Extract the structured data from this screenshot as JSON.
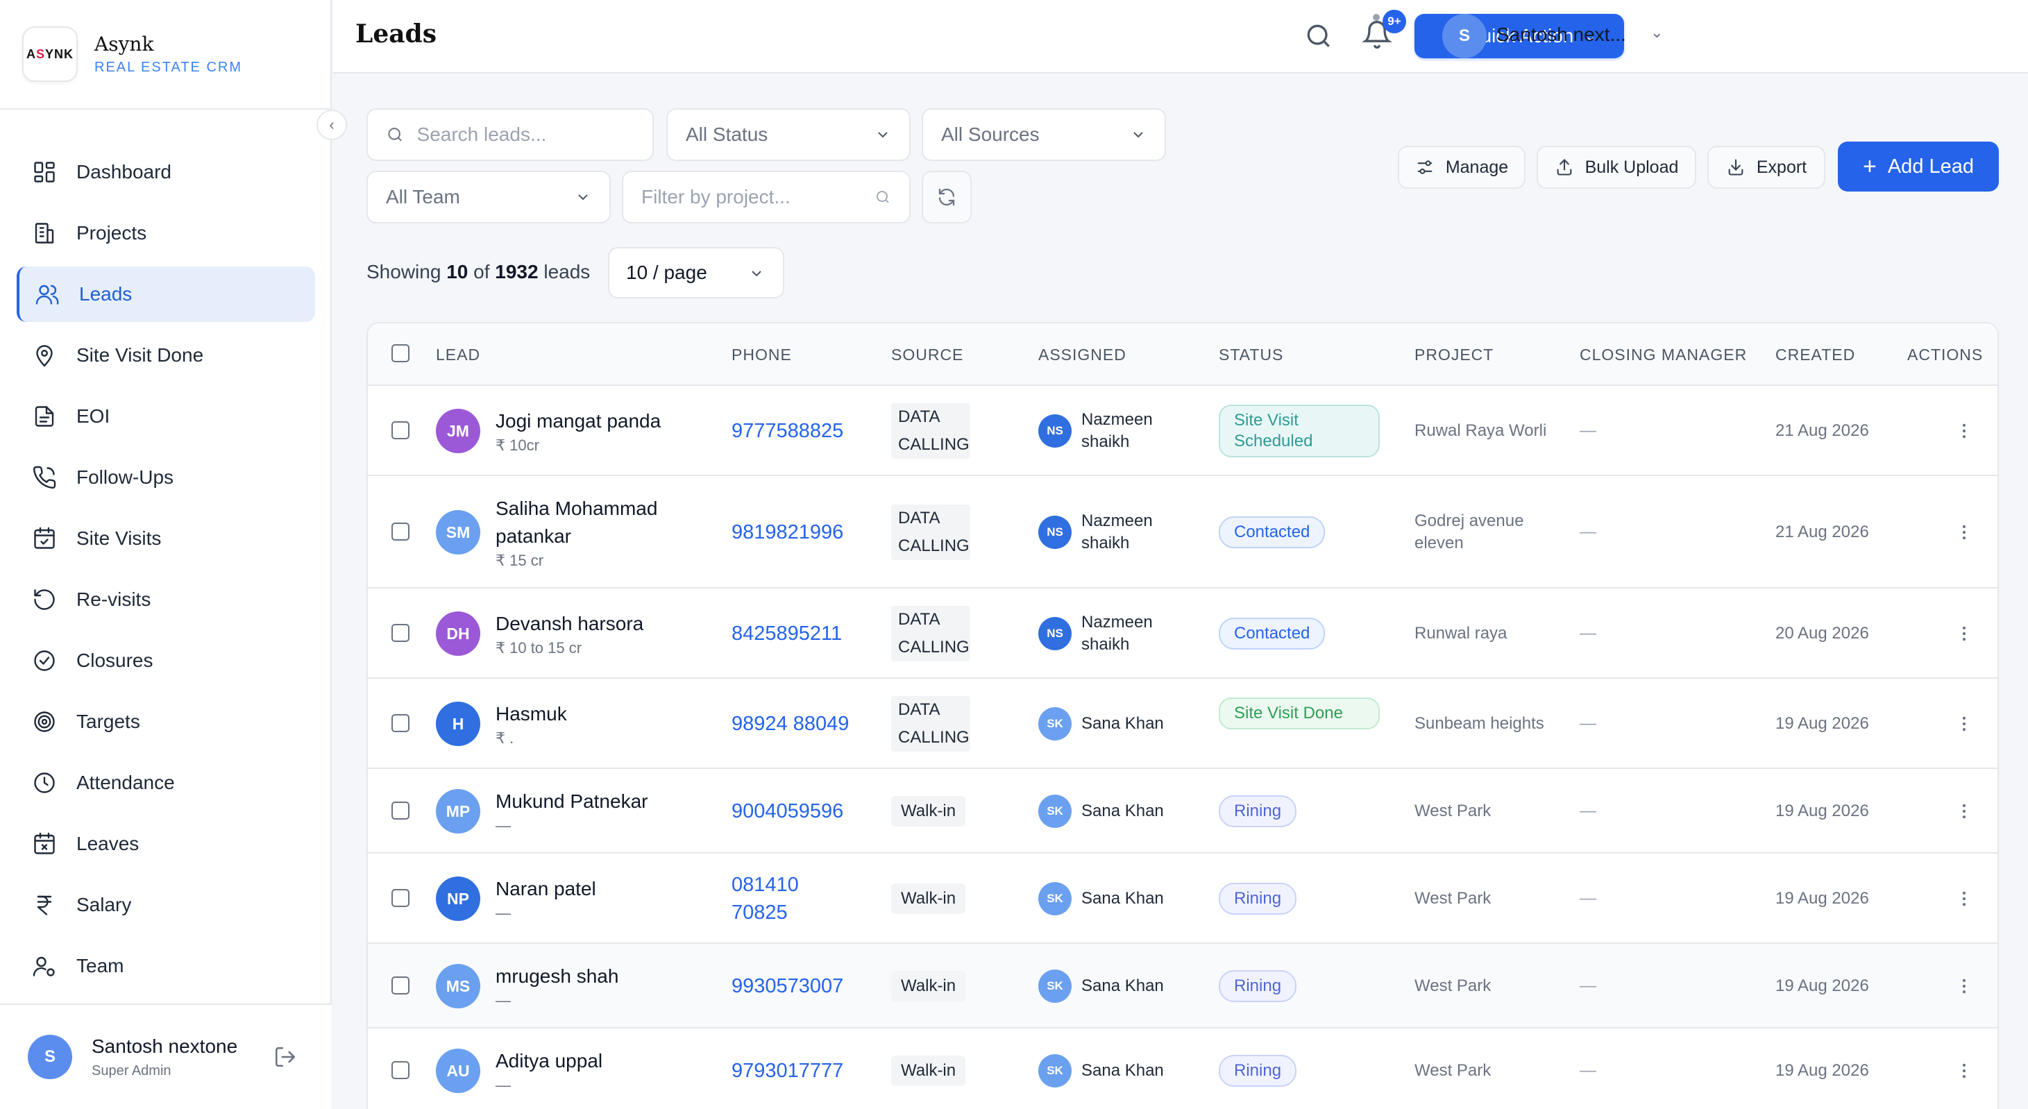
{
  "brand": {
    "logo_left": "A",
    "logo_mid": "S",
    "logo_right": "YNK",
    "name": "Asynk",
    "subtitle": "REAL ESTATE CRM"
  },
  "sidebar": {
    "items": [
      {
        "label": "Dashboard",
        "icon": "dashboard-icon"
      },
      {
        "label": "Projects",
        "icon": "building-icon"
      },
      {
        "label": "Leads",
        "icon": "users-icon",
        "active": true
      },
      {
        "label": "Site Visit Done",
        "icon": "map-pin-icon"
      },
      {
        "label": "EOI",
        "icon": "document-icon"
      },
      {
        "label": "Follow-Ups",
        "icon": "phone-icon"
      },
      {
        "label": "Site Visits",
        "icon": "calendar-check-icon"
      },
      {
        "label": "Re-visits",
        "icon": "rotate-icon"
      },
      {
        "label": "Closures",
        "icon": "check-circle-icon"
      },
      {
        "label": "Targets",
        "icon": "target-icon"
      },
      {
        "label": "Attendance",
        "icon": "clock-icon"
      },
      {
        "label": "Leaves",
        "icon": "calendar-x-icon"
      },
      {
        "label": "Salary",
        "icon": "rupee-icon"
      },
      {
        "label": "Team",
        "icon": "user-cog-icon"
      }
    ],
    "footer": {
      "initial": "S",
      "name": "Santosh nextone",
      "role": "Super Admin"
    }
  },
  "header": {
    "title": "Leads",
    "quick_action": "Quick Action",
    "notification_badge": "9+",
    "user_initial": "S",
    "user_name": "Santosh next..."
  },
  "filters": {
    "search_placeholder": "Search leads...",
    "status": "All Status",
    "sources": "All Sources",
    "team": "All Team",
    "project_placeholder": "Filter by project..."
  },
  "toolbar": {
    "manage": "Manage",
    "bulk_upload": "Bulk Upload",
    "export": "Export",
    "add_lead": "Add Lead"
  },
  "summary": {
    "prefix": "Showing",
    "shown": "10",
    "of": "of",
    "total": "1932",
    "suffix": "leads",
    "per_page": "10 / page"
  },
  "table": {
    "headers": [
      "LEAD",
      "PHONE",
      "SOURCE",
      "ASSIGNED",
      "STATUS",
      "PROJECT",
      "CLOSING MANAGER",
      "CREATED",
      "ACTIONS"
    ],
    "rows": [
      {
        "initials": "JM",
        "avatar_color": "#9b59d8",
        "name": "Jogi mangat panda",
        "budget": "₹ 10cr",
        "phone": "9777588825",
        "source": "DATA CALLING",
        "assigned_initials": "NS",
        "assigned_color": "#2f6fe0",
        "assigned": "Nazmeen shaikh",
        "status": "Site Visit Scheduled",
        "status_tone": "teal",
        "project": "Ruwal Raya Worli",
        "closing_manager": "—",
        "created": "21 Aug 2026"
      },
      {
        "initials": "SM",
        "avatar_color": "#6aa0ef",
        "name": "Saliha Mohammad patankar",
        "budget": "₹ 15 cr",
        "phone": "9819821996",
        "source": "DATA CALLING",
        "assigned_initials": "NS",
        "assigned_color": "#2f6fe0",
        "assigned": "Nazmeen shaikh",
        "status": "Contacted",
        "status_tone": "blue",
        "project": "Godrej avenue eleven",
        "closing_manager": "—",
        "created": "21 Aug 2026"
      },
      {
        "initials": "DH",
        "avatar_color": "#9b59d8",
        "name": "Devansh harsora",
        "budget": "₹ 10 to 15 cr",
        "phone": "8425895211",
        "source": "DATA CALLING",
        "assigned_initials": "NS",
        "assigned_color": "#2f6fe0",
        "assigned": "Nazmeen shaikh",
        "status": "Contacted",
        "status_tone": "blue",
        "project": "Runwal raya",
        "closing_manager": "—",
        "created": "20 Aug 2026"
      },
      {
        "initials": "H",
        "avatar_color": "#2f6fe0",
        "name": "Hasmuk",
        "budget": "₹ .",
        "phone": "98924 88049",
        "source": "DATA CALLING",
        "assigned_initials": "SK",
        "assigned_color": "#6aa0ef",
        "assigned": "Sana Khan",
        "status": "Site Visit Done",
        "status_tone": "green",
        "project": "Sunbeam heights",
        "closing_manager": "—",
        "created": "19 Aug 2026"
      },
      {
        "initials": "MP",
        "avatar_color": "#6aa0ef",
        "name": "Mukund Patnekar",
        "budget": "—",
        "phone": "9004059596",
        "source": "Walk-in",
        "assigned_initials": "SK",
        "assigned_color": "#6aa0ef",
        "assigned": "Sana Khan",
        "status": "Rining",
        "status_tone": "purple",
        "project": "West Park",
        "closing_manager": "—",
        "created": "19 Aug 2026"
      },
      {
        "initials": "NP",
        "avatar_color": "#2f6fe0",
        "name": "Naran patel",
        "budget": "—",
        "phone": "081410 70825",
        "source": "Walk-in",
        "assigned_initials": "SK",
        "assigned_color": "#6aa0ef",
        "assigned": "Sana Khan",
        "status": "Rining",
        "status_tone": "purple",
        "project": "West Park",
        "closing_manager": "—",
        "created": "19 Aug 2026"
      },
      {
        "initials": "MS",
        "avatar_color": "#6aa0ef",
        "name": "mrugesh shah",
        "budget": "—",
        "phone": "9930573007",
        "source": "Walk-in",
        "assigned_initials": "SK",
        "assigned_color": "#6aa0ef",
        "assigned": "Sana Khan",
        "status": "Rining",
        "status_tone": "purple",
        "project": "West Park",
        "closing_manager": "—",
        "created": "19 Aug 2026"
      },
      {
        "initials": "AU",
        "avatar_color": "#6aa0ef",
        "name": "Aditya uppal",
        "budget": "—",
        "phone": "9793017777",
        "source": "Walk-in",
        "assigned_initials": "SK",
        "assigned_color": "#6aa0ef",
        "assigned": "Sana Khan",
        "status": "Rining",
        "status_tone": "purple",
        "project": "West Park",
        "closing_manager": "—",
        "created": "19 Aug 2026"
      }
    ]
  },
  "colors": {
    "accent": "#2563eb",
    "active_bg": "#e6eefb"
  }
}
